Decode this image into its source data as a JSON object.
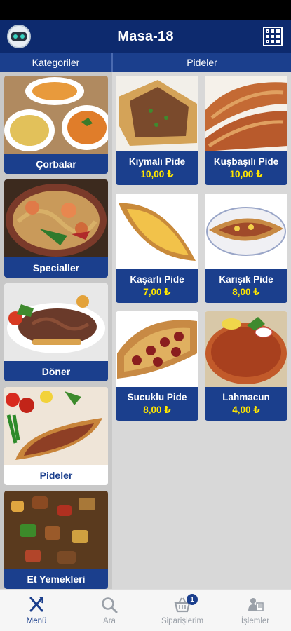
{
  "header": {
    "title": "Masa-18"
  },
  "sections": {
    "categories_title": "Kategoriler",
    "products_title": "Pideler"
  },
  "categories": [
    {
      "label": "Çorbalar",
      "active": false
    },
    {
      "label": "Specialler",
      "active": false
    },
    {
      "label": "Döner",
      "active": false
    },
    {
      "label": "Pideler",
      "active": true
    },
    {
      "label": "Et Yemekleri",
      "active": false
    }
  ],
  "products": [
    {
      "name": "Kıymalı Pide",
      "price": "10,00 ₺"
    },
    {
      "name": "Kuşbaşılı Pide",
      "price": "10,00 ₺"
    },
    {
      "name": "Kaşarlı Pide",
      "price": "7,00 ₺"
    },
    {
      "name": "Karışık Pide",
      "price": "8,00 ₺"
    },
    {
      "name": "Sucuklu Pide",
      "price": "8,00 ₺"
    },
    {
      "name": "Lahmacun",
      "price": "4,00 ₺"
    }
  ],
  "tabs": [
    {
      "label": "Menü",
      "icon": "fork-knife-icon",
      "active": true
    },
    {
      "label": "Ara",
      "icon": "search-icon",
      "active": false
    },
    {
      "label": "Siparişlerim",
      "icon": "basket-icon",
      "active": false,
      "badge": "1"
    },
    {
      "label": "İşlemler",
      "icon": "user-tasks-icon",
      "active": false
    }
  ],
  "colors": {
    "primary": "#1b3f8d",
    "header": "#0d2a6e",
    "price": "#ffe600"
  }
}
